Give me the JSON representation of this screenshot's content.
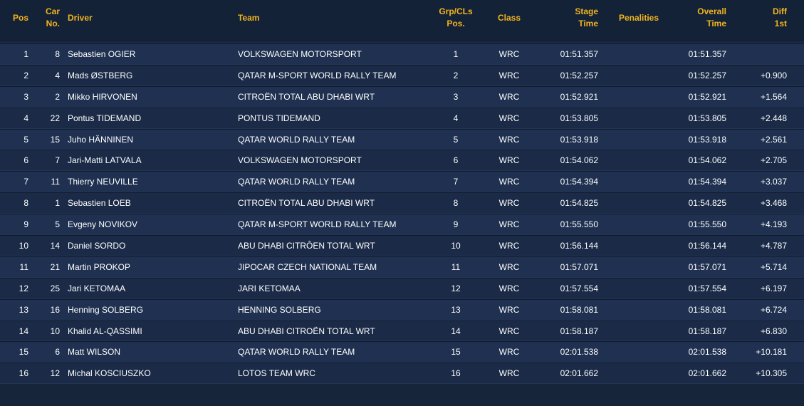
{
  "columns": {
    "pos": "Pos",
    "car_line1": "Car",
    "car_line2": "No.",
    "driver": "Driver",
    "team": "Team",
    "grp_line1": "Grp/CLs",
    "grp_line2": "Pos.",
    "class": "Class",
    "stage_line1": "Stage",
    "stage_line2": "Time",
    "penalties": "Penalities",
    "overall_line1": "Overall",
    "overall_line2": "Time",
    "diff_line1": "Diff",
    "diff_line2": "1st"
  },
  "rows": [
    {
      "pos": "1",
      "car": "8",
      "driver": "Sebastien OGIER",
      "team": "VOLKSWAGEN MOTORSPORT",
      "grp": "1",
      "class": "WRC",
      "stage": "01:51.357",
      "penalties": "",
      "overall": "01:51.357",
      "diff": ""
    },
    {
      "pos": "2",
      "car": "4",
      "driver": "Mads ØSTBERG",
      "team": "QATAR M-SPORT WORLD RALLY TEAM",
      "grp": "2",
      "class": "WRC",
      "stage": "01:52.257",
      "penalties": "",
      "overall": "01:52.257",
      "diff": "+0.900"
    },
    {
      "pos": "3",
      "car": "2",
      "driver": "Mikko HIRVONEN",
      "team": "CITROËN TOTAL ABU DHABI WRT",
      "grp": "3",
      "class": "WRC",
      "stage": "01:52.921",
      "penalties": "",
      "overall": "01:52.921",
      "diff": "+1.564"
    },
    {
      "pos": "4",
      "car": "22",
      "driver": "Pontus TIDEMAND",
      "team": "PONTUS TIDEMAND",
      "grp": "4",
      "class": "WRC",
      "stage": "01:53.805",
      "penalties": "",
      "overall": "01:53.805",
      "diff": "+2.448"
    },
    {
      "pos": "5",
      "car": "15",
      "driver": "Juho HÄNNINEN",
      "team": "QATAR WORLD RALLY TEAM",
      "grp": "5",
      "class": "WRC",
      "stage": "01:53.918",
      "penalties": "",
      "overall": "01:53.918",
      "diff": "+2.561"
    },
    {
      "pos": "6",
      "car": "7",
      "driver": "Jari-Matti LATVALA",
      "team": "VOLKSWAGEN MOTORSPORT",
      "grp": "6",
      "class": "WRC",
      "stage": "01:54.062",
      "penalties": "",
      "overall": "01:54.062",
      "diff": "+2.705"
    },
    {
      "pos": "7",
      "car": "11",
      "driver": "Thierry NEUVILLE",
      "team": "QATAR WORLD RALLY TEAM",
      "grp": "7",
      "class": "WRC",
      "stage": "01:54.394",
      "penalties": "",
      "overall": "01:54.394",
      "diff": "+3.037"
    },
    {
      "pos": "8",
      "car": "1",
      "driver": "Sebastien LOEB",
      "team": "CITROËN TOTAL ABU DHABI WRT",
      "grp": "8",
      "class": "WRC",
      "stage": "01:54.825",
      "penalties": "",
      "overall": "01:54.825",
      "diff": "+3.468"
    },
    {
      "pos": "9",
      "car": "5",
      "driver": "Evgeny NOVIKOV",
      "team": "QATAR M-SPORT WORLD RALLY TEAM",
      "grp": "9",
      "class": "WRC",
      "stage": "01:55.550",
      "penalties": "",
      "overall": "01:55.550",
      "diff": "+4.193"
    },
    {
      "pos": "10",
      "car": "14",
      "driver": "Daniel SORDO",
      "team": "ABU DHABI CITRÔEN TOTAL WRT",
      "grp": "10",
      "class": "WRC",
      "stage": "01:56.144",
      "penalties": "",
      "overall": "01:56.144",
      "diff": "+4.787"
    },
    {
      "pos": "11",
      "car": "21",
      "driver": "Martin PROKOP",
      "team": "JIPOCAR CZECH NATIONAL TEAM",
      "grp": "11",
      "class": "WRC",
      "stage": "01:57.071",
      "penalties": "",
      "overall": "01:57.071",
      "diff": "+5.714"
    },
    {
      "pos": "12",
      "car": "25",
      "driver": "Jari KETOMAA",
      "team": "JARI KETOMAA",
      "grp": "12",
      "class": "WRC",
      "stage": "01:57.554",
      "penalties": "",
      "overall": "01:57.554",
      "diff": "+6.197"
    },
    {
      "pos": "13",
      "car": "16",
      "driver": "Henning SOLBERG",
      "team": "HENNING SOLBERG",
      "grp": "13",
      "class": "WRC",
      "stage": "01:58.081",
      "penalties": "",
      "overall": "01:58.081",
      "diff": "+6.724"
    },
    {
      "pos": "14",
      "car": "10",
      "driver": "Khalid AL-QASSIMI",
      "team": "ABU DHABI CITROËN TOTAL WRT",
      "grp": "14",
      "class": "WRC",
      "stage": "01:58.187",
      "penalties": "",
      "overall": "01:58.187",
      "diff": "+6.830"
    },
    {
      "pos": "15",
      "car": "6",
      "driver": "Matt WILSON",
      "team": "QATAR WORLD RALLY TEAM",
      "grp": "15",
      "class": "WRC",
      "stage": "02:01.538",
      "penalties": "",
      "overall": "02:01.538",
      "diff": "+10.181"
    },
    {
      "pos": "16",
      "car": "12",
      "driver": "Michal KOSCIUSZKO",
      "team": "LOTOS TEAM WRC",
      "grp": "16",
      "class": "WRC",
      "stage": "02:01.662",
      "penalties": "",
      "overall": "02:01.662",
      "diff": "+10.305"
    }
  ]
}
